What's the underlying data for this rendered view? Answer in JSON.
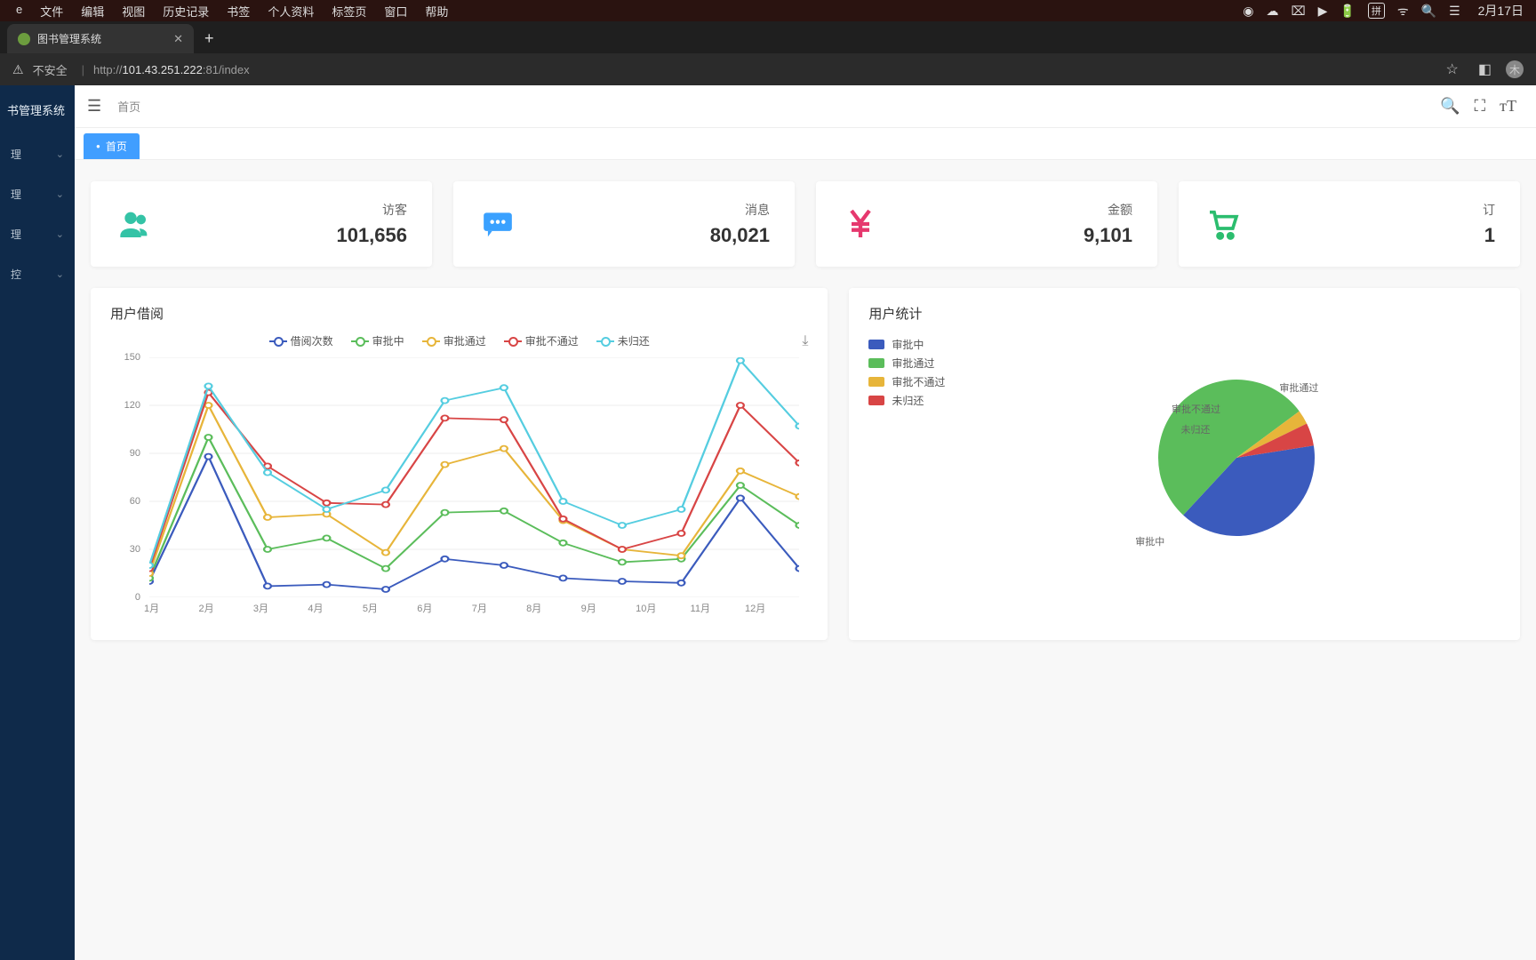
{
  "os": {
    "menus": [
      "e",
      "文件",
      "编辑",
      "视图",
      "历史记录",
      "书签",
      "个人资料",
      "标签页",
      "窗口",
      "帮助"
    ],
    "clock": "2月17日"
  },
  "browser": {
    "tab_title": "图书管理系统",
    "url_prefix": "http://",
    "url_host": "101.43.251.222",
    "url_rest": ":81/index",
    "insecure_label": "不安全"
  },
  "sidebar": {
    "brand": "书管理系统",
    "items": [
      "理",
      "理",
      "理",
      "控"
    ]
  },
  "topbar": {
    "breadcrumb": "首页"
  },
  "tabs": {
    "home": "首页"
  },
  "cards": [
    {
      "label": "访客",
      "value": "101,656",
      "color": "#34c3a6",
      "icon": "users"
    },
    {
      "label": "消息",
      "value": "80,021",
      "color": "#3aa1ff",
      "icon": "chat"
    },
    {
      "label": "金额",
      "value": "9,101",
      "color": "#e6386e",
      "icon": "yen"
    },
    {
      "label": "订",
      "value": "1",
      "color": "#2bbd6e",
      "icon": "cart"
    }
  ],
  "panels": {
    "borrow_title": "用户借阅",
    "stats_title": "用户统计"
  },
  "chart_data": [
    {
      "type": "line",
      "title": "用户借阅",
      "categories": [
        "1月",
        "2月",
        "3月",
        "4月",
        "5月",
        "6月",
        "7月",
        "8月",
        "9月",
        "10月",
        "11月",
        "12月"
      ],
      "ylim": [
        0,
        150
      ],
      "yticks": [
        0,
        30,
        60,
        90,
        120,
        150
      ],
      "series": [
        {
          "name": "借阅次数",
          "color": "#3b5bbd",
          "values": [
            10,
            88,
            7,
            8,
            5,
            24,
            20,
            12,
            10,
            9,
            62,
            18
          ]
        },
        {
          "name": "审批中",
          "color": "#5bbd5b",
          "values": [
            12,
            100,
            30,
            37,
            18,
            53,
            54,
            34,
            22,
            24,
            70,
            45
          ]
        },
        {
          "name": "审批通过",
          "color": "#e7b53a",
          "values": [
            15,
            120,
            50,
            52,
            28,
            83,
            93,
            48,
            30,
            26,
            79,
            63
          ]
        },
        {
          "name": "审批不通过",
          "color": "#d84545",
          "values": [
            18,
            128,
            82,
            59,
            58,
            112,
            111,
            49,
            30,
            40,
            120,
            84
          ]
        },
        {
          "name": "未归还",
          "color": "#55cde0",
          "values": [
            20,
            132,
            78,
            55,
            67,
            123,
            131,
            60,
            45,
            55,
            148,
            107
          ]
        }
      ]
    },
    {
      "type": "pie",
      "title": "用户统计",
      "series": [
        {
          "name": "审批中",
          "color": "#3b5bbd",
          "value": 335
        },
        {
          "name": "审批通过",
          "color": "#5bbd5b",
          "value": 450
        },
        {
          "name": "审批不通过",
          "color": "#e7b53a",
          "value": 25
        },
        {
          "name": "未归还",
          "color": "#d84545",
          "value": 40
        }
      ]
    }
  ]
}
